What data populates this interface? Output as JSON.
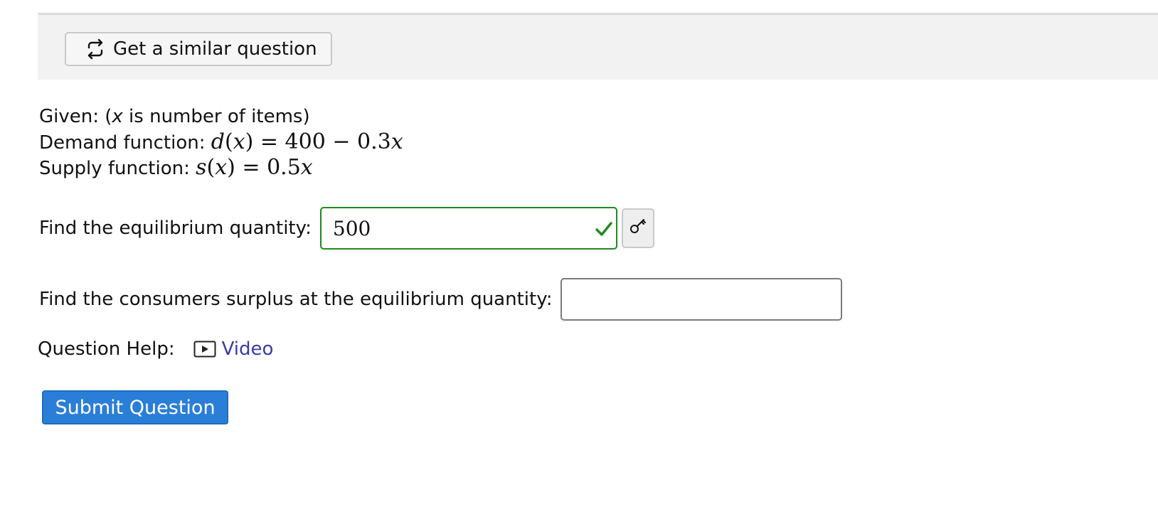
{
  "toolbar": {
    "similar_question_label": "Get a similar question",
    "similar_question_icon": "repeat-arrows-icon"
  },
  "given": {
    "intro_prefix": "Given: (",
    "intro_var": "x",
    "intro_suffix": " is number of items)",
    "demand_label": "Demand function: ",
    "demand_lhs_fn": "d",
    "demand_lhs_var": "x",
    "demand_rhs_prefix": " = 400 − 0.3",
    "demand_rhs_var": "x",
    "supply_label": "Supply function: ",
    "supply_lhs_fn": "s",
    "supply_lhs_var": "x",
    "supply_rhs_prefix": " = 0.5",
    "supply_rhs_var": "x"
  },
  "questions": [
    {
      "prompt": "Find the equilibrium quantity:",
      "answer_value": "500",
      "status": "correct",
      "status_icon": "checkmark-icon",
      "status_color": "#1e8a1e",
      "key_icon": "key-icon"
    },
    {
      "prompt": "Find the consumers surplus at the equilibrium quantity:",
      "answer_value": ""
    }
  ],
  "help": {
    "label": "Question Help:",
    "video_label": "Video",
    "video_icon": "play-video-icon",
    "link_color": "#3a3aa8"
  },
  "submit": {
    "label": "Submit Question",
    "color": "#2a7ed8"
  }
}
